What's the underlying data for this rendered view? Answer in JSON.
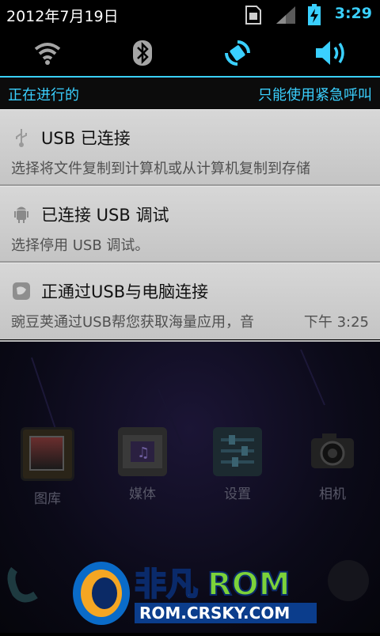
{
  "status_bar": {
    "date": "2012年7月19日",
    "time": "3:29",
    "icons": [
      "sim-card-icon",
      "signal-icon",
      "battery-charging-icon"
    ]
  },
  "quick_toggles": [
    {
      "icon": "wifi-icon",
      "active": false
    },
    {
      "icon": "bluetooth-icon",
      "active": false
    },
    {
      "icon": "auto-rotate-icon",
      "active": true
    },
    {
      "icon": "volume-icon",
      "active": true
    }
  ],
  "ongoing": {
    "left_label": "正在进行的",
    "right_label": "只能使用紧急呼叫"
  },
  "notifications": [
    {
      "icon": "usb-icon",
      "title": "USB 已连接",
      "body": "选择将文件复制到计算机或从计算机复制到存储"
    },
    {
      "icon": "android-debug-icon",
      "title": "已连接 USB 调试",
      "body": "选择停用 USB 调试。"
    },
    {
      "icon": "wandoujia-icon",
      "title": "正通过USB与电脑连接",
      "body": "豌豆荚通过USB帮您获取海量应用，音",
      "time": "下午 3:25"
    }
  ],
  "home_apps": [
    {
      "label": "图库",
      "icon": "gallery-icon"
    },
    {
      "label": "媒体",
      "icon": "media-icon"
    },
    {
      "label": "设置",
      "icon": "settings-icon"
    },
    {
      "label": "相机",
      "icon": "camera-icon"
    }
  ],
  "watermark": {
    "brand": "非凡ROM",
    "url": "ROM.CRSKY.COM"
  },
  "colors": {
    "accent": "#3ad0ff",
    "notification_bg": "#cfcfcf"
  }
}
